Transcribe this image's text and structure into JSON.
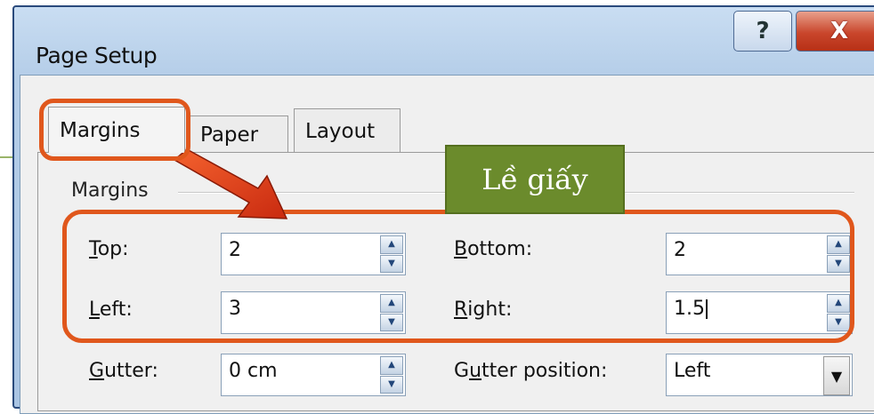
{
  "window": {
    "title": "Page Setup",
    "help_glyph": "?",
    "close_glyph": "X"
  },
  "tabs": [
    {
      "label": "Margins",
      "selected": true
    },
    {
      "label": "Paper",
      "selected": false
    },
    {
      "label": "Layout",
      "selected": false
    }
  ],
  "group": {
    "label": "Margins"
  },
  "fields": {
    "top": {
      "label_u": "T",
      "label_rest": "op:",
      "value": "2"
    },
    "bottom": {
      "label_u": "B",
      "label_rest": "ottom:",
      "value": "2"
    },
    "left": {
      "label_u": "L",
      "label_rest": "eft:",
      "value": "3"
    },
    "right": {
      "label_u": "R",
      "label_rest": "ight:",
      "value": "1.5"
    },
    "gutter": {
      "label_u": "G",
      "label_rest": "utter:",
      "value": "0 cm"
    },
    "gutter_position": {
      "label_pre": "G",
      "label_u": "u",
      "label_rest": "tter position:",
      "value": "Left"
    }
  },
  "annotation": {
    "text": "Lề giấy"
  },
  "colors": {
    "highlight": "#e0571c",
    "callout_bg": "#6b8b2c",
    "close_btn": "#c9462c"
  },
  "icons": {
    "spin_up": "▲",
    "spin_down": "▼",
    "dropdown": "▼"
  }
}
